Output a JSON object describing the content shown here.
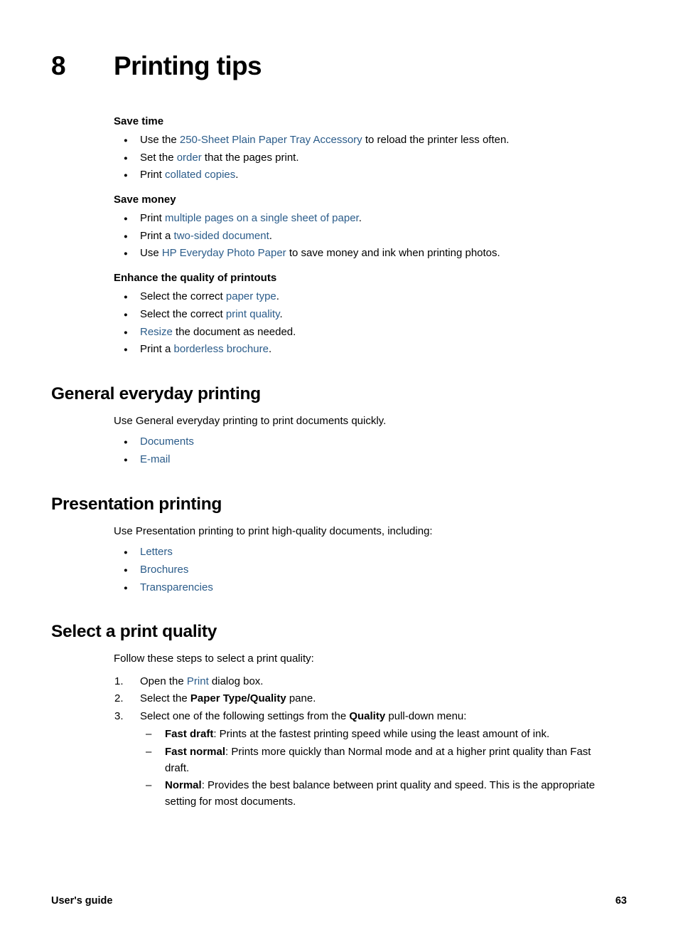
{
  "chapter": {
    "number": "8",
    "title": "Printing tips"
  },
  "subheads": {
    "save_time": "Save time",
    "save_money": "Save money",
    "enhance_quality": "Enhance the quality of printouts"
  },
  "save_time_bullets": [
    {
      "pre": "Use the ",
      "link": "250-Sheet Plain Paper Tray Accessory",
      "post": " to reload the printer less often."
    },
    {
      "pre": "Set the ",
      "link": "order",
      "post": " that the pages print."
    },
    {
      "pre": "Print ",
      "link": "collated copies",
      "post": "."
    }
  ],
  "save_money_bullets": [
    {
      "pre": "Print ",
      "link": "multiple pages on a single sheet of paper",
      "post": "."
    },
    {
      "pre": "Print a ",
      "link": "two-sided document",
      "post": "."
    },
    {
      "pre": "Use ",
      "link": "HP Everyday Photo Paper",
      "post": " to save money and ink when printing photos."
    }
  ],
  "enhance_quality_bullets": [
    {
      "pre": "Select the correct ",
      "link": "paper type",
      "post": "."
    },
    {
      "pre": "Select the correct ",
      "link": "print quality",
      "post": "."
    },
    {
      "pre": "",
      "link": "Resize",
      "post": " the document as needed."
    },
    {
      "pre": "Print a ",
      "link": "borderless brochure",
      "post": "."
    }
  ],
  "general_everyday": {
    "title": "General everyday printing",
    "intro": "Use General everyday printing to print documents quickly.",
    "links": [
      "Documents",
      "E-mail"
    ]
  },
  "presentation": {
    "title": "Presentation printing",
    "intro": "Use Presentation printing to print high-quality documents, including:",
    "links": [
      "Letters",
      "Brochures",
      "Transparencies"
    ]
  },
  "print_quality": {
    "title": "Select a print quality",
    "intro": "Follow these steps to select a print quality:",
    "steps": [
      {
        "pre": "Open the ",
        "link": "Print",
        "post": " dialog box."
      },
      {
        "pre": "Select the ",
        "bold": "Paper Type/Quality",
        "post": " pane."
      },
      {
        "pre": "Select one of the following settings from the ",
        "bold": "Quality",
        "post": " pull-down menu:"
      }
    ],
    "settings": [
      {
        "term": "Fast draft",
        "desc": ": Prints at the fastest printing speed while using the least amount of ink."
      },
      {
        "term": "Fast normal",
        "desc": ": Prints more quickly than Normal mode and at a higher print quality than Fast draft."
      },
      {
        "term": "Normal",
        "desc": ": Provides the best balance between print quality and speed. This is the appropriate setting for most documents."
      }
    ]
  },
  "footer": {
    "left": "User's guide",
    "page": "63"
  },
  "colors": {
    "link": "#2B5C8A",
    "text": "#000000",
    "background": "#FFFFFF"
  }
}
